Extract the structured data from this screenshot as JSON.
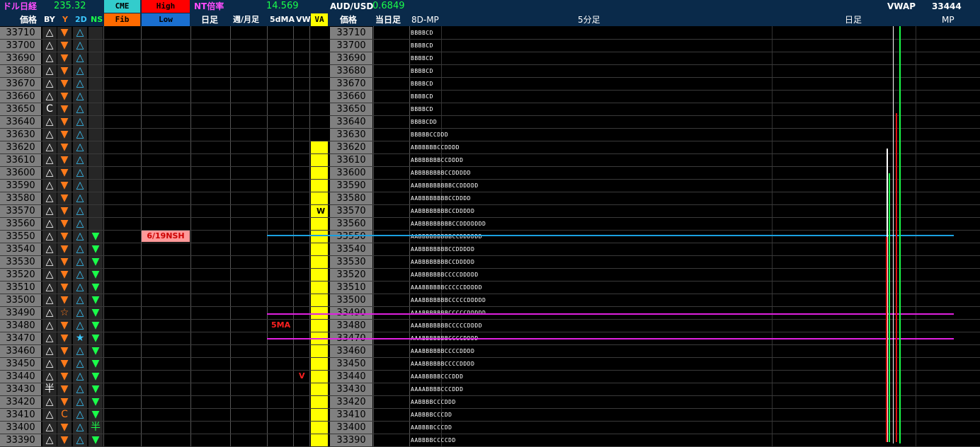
{
  "header": {
    "dollar_nikkei_label": "ドル日経",
    "dollar_nikkei_value": "235.32",
    "cme_label": "CME",
    "high_label": "High",
    "nt_label": "NT倍率",
    "nt_value": "14.569",
    "audusd_label": "AUD/USD",
    "audusd_value": "0.6849",
    "vwap_label": "VWAP",
    "vwap_value": "33444",
    "price_label": "価格",
    "by_label": "BY",
    "y_label": "Y",
    "two_d_label": "2D",
    "ns_label": "NS",
    "fib_label": "Fib",
    "low_label": "Low",
    "daily_label": "日足",
    "weekly_monthly_label": "週/月足",
    "ma5_label": "5dMA",
    "vw_label": "VW",
    "va_label": "VA",
    "price_label_2": "価格",
    "today_label": "当日足",
    "mp8d_label": "8D-MP",
    "min5_label": "5分足",
    "daily_label_2": "日足",
    "mp_label": "MP"
  },
  "colors": {
    "header_bg": "#0a2a4a",
    "cme_bg": "#33cccc",
    "high_bg": "#ff0000",
    "fib_bg": "#ff6a00",
    "low_bg": "#1a6fd0",
    "va_bg": "#ffff00",
    "blue_line": "#1aa0e0",
    "magenta_line": "#e020e0"
  },
  "markers": {
    "nsh_label": "6/19NSH",
    "ma5_tag": "5MA",
    "vw_tag": "V",
    "va_tag": "W"
  },
  "rows": [
    {
      "price": "33710",
      "by": "△",
      "y": "▼",
      "td": "△",
      "ns": "",
      "tpo": "BBBBCD"
    },
    {
      "price": "33700",
      "by": "△",
      "y": "▼",
      "td": "△",
      "ns": "",
      "tpo": "BBBBCD"
    },
    {
      "price": "33690",
      "by": "△",
      "y": "▼",
      "td": "△",
      "ns": "",
      "tpo": "BBBBCD"
    },
    {
      "price": "33680",
      "by": "△",
      "y": "▼",
      "td": "△",
      "ns": "",
      "tpo": "BBBBCD"
    },
    {
      "price": "33670",
      "by": "△",
      "y": "▼",
      "td": "△",
      "ns": "",
      "tpo": "BBBBCD"
    },
    {
      "price": "33660",
      "by": "△",
      "y": "▼",
      "td": "△",
      "ns": "",
      "tpo": "BBBBCD"
    },
    {
      "price": "33650",
      "by": "C",
      "y": "▼",
      "td": "△",
      "ns": "",
      "tpo": "BBBBCD"
    },
    {
      "price": "33640",
      "by": "△",
      "y": "▼",
      "td": "△",
      "ns": "",
      "tpo": "BBBBCDD"
    },
    {
      "price": "33630",
      "by": "△",
      "y": "▼",
      "td": "△",
      "ns": "",
      "tpo": "BBBBBCCDDD"
    },
    {
      "price": "33620",
      "by": "△",
      "y": "▼",
      "td": "△",
      "ns": "",
      "tpo": "ABBBBBBCCDDDD"
    },
    {
      "price": "33610",
      "by": "△",
      "y": "▼",
      "td": "△",
      "ns": "",
      "tpo": "ABBBBBBBCCDDDD"
    },
    {
      "price": "33600",
      "by": "△",
      "y": "▼",
      "td": "△",
      "ns": "",
      "tpo": "ABBBBBBBBCCDDDDD"
    },
    {
      "price": "33590",
      "by": "△",
      "y": "▼",
      "td": "△",
      "ns": "",
      "tpo": "AABBBBBBBBBCCDDDDD"
    },
    {
      "price": "33580",
      "by": "△",
      "y": "▼",
      "td": "△",
      "ns": "",
      "tpo": "AABBBBBBBBCCDDDD"
    },
    {
      "price": "33570",
      "by": "△",
      "y": "▼",
      "td": "△",
      "ns": "",
      "tpo": "AABBBBBBBBCCDDDDD"
    },
    {
      "price": "33560",
      "by": "△",
      "y": "▼",
      "td": "△",
      "ns": "",
      "tpo": "AABBBBBBBBBCCDDDDDDD"
    },
    {
      "price": "33550",
      "by": "△",
      "y": "▼",
      "td": "△",
      "ns": "▼",
      "tpo": "AABBBBBBBBBCCDDDDDD"
    },
    {
      "price": "33540",
      "by": "△",
      "y": "▼",
      "td": "△",
      "ns": "▼",
      "tpo": "AABBBBBBBBCCDDDDD"
    },
    {
      "price": "33530",
      "by": "△",
      "y": "▼",
      "td": "△",
      "ns": "▼",
      "tpo": "AABBBBBBBBCCDDDDD"
    },
    {
      "price": "33520",
      "by": "△",
      "y": "▼",
      "td": "△",
      "ns": "▼",
      "tpo": "AABBBBBBBCCCCDDDDD"
    },
    {
      "price": "33510",
      "by": "△",
      "y": "▼",
      "td": "△",
      "ns": "▼",
      "tpo": "AAABBBBBBCCCCCDDDDD"
    },
    {
      "price": "33500",
      "by": "△",
      "y": "▼",
      "td": "△",
      "ns": "▼",
      "tpo": "AAABBBBBBBCCCCCDDDDD"
    },
    {
      "price": "33490",
      "by": "△",
      "y": "☆",
      "td": "△",
      "ns": "▼",
      "tpo": "AAABBBBBBBCCCCCDDDDD"
    },
    {
      "price": "33480",
      "by": "△",
      "y": "▼",
      "td": "△",
      "ns": "▼",
      "tpo": "AAABBBBBBBCCCCCDDDD"
    },
    {
      "price": "33470",
      "by": "△",
      "y": "▼",
      "td": "★",
      "ns": "▼",
      "tpo": "AAABBBBBBBCCCCDDDD"
    },
    {
      "price": "33460",
      "by": "△",
      "y": "▼",
      "td": "△",
      "ns": "▼",
      "tpo": "AAABBBBBBCCCCDDDD"
    },
    {
      "price": "33450",
      "by": "△",
      "y": "▼",
      "td": "△",
      "ns": "▼",
      "tpo": "AAABBBBBBCCCCDDDD"
    },
    {
      "price": "33440",
      "by": "△",
      "y": "▼",
      "td": "△",
      "ns": "▼",
      "tpo": "AAABBBBBCCCDDD"
    },
    {
      "price": "33430",
      "by": "半",
      "y": "▼",
      "td": "△",
      "ns": "▼",
      "tpo": "AAAABBBBCCCDDD"
    },
    {
      "price": "33420",
      "by": "△",
      "y": "▼",
      "td": "△",
      "ns": "▼",
      "tpo": "AABBBBCCCDDD"
    },
    {
      "price": "33410",
      "by": "△",
      "y": "C",
      "td": "△",
      "ns": "▼",
      "tpo": "AABBBBCCCDD"
    },
    {
      "price": "33400",
      "by": "△",
      "y": "▼",
      "td": "△",
      "ns": "半",
      "tpo": "AABBBBCCCDD"
    },
    {
      "price": "33390",
      "by": "△",
      "y": "▼",
      "td": "△",
      "ns": "▼",
      "tpo": "AABBBBCCCCDD"
    }
  ]
}
